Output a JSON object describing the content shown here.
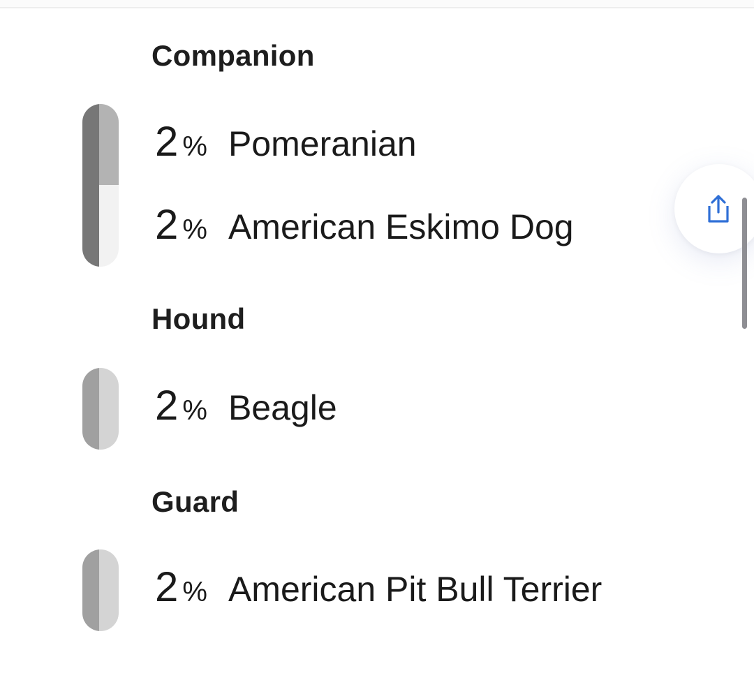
{
  "groups": [
    {
      "title": "Companion",
      "breeds": [
        {
          "percent": "2",
          "percent_sign": "%",
          "name": "Pomeranian"
        },
        {
          "percent": "2",
          "percent_sign": "%",
          "name": "American Eskimo Dog"
        }
      ]
    },
    {
      "title": "Hound",
      "breeds": [
        {
          "percent": "2",
          "percent_sign": "%",
          "name": "Beagle"
        }
      ]
    },
    {
      "title": "Guard",
      "breeds": [
        {
          "percent": "2",
          "percent_sign": "%",
          "name": "American Pit Bull Terrier"
        }
      ]
    }
  ],
  "colors": {
    "companion_dark": "#777777",
    "companion_mid": "#b3b3b3",
    "companion_light": "#f2f2f2",
    "hound_dark": "#a0a0a0",
    "hound_light": "#d4d4d4",
    "accent_blue": "#2f6fd6",
    "scrollbar": "#8e8e93"
  },
  "icons": {
    "share": "share-icon"
  }
}
